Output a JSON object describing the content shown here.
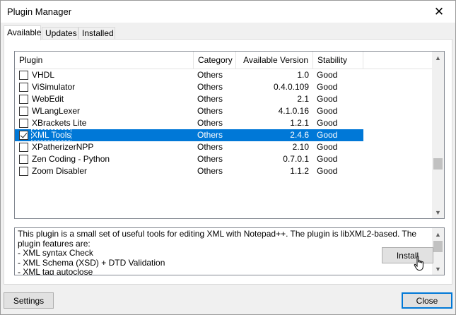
{
  "window": {
    "title": "Plugin Manager",
    "close_glyph": "✕"
  },
  "tabs": [
    {
      "label": "Available",
      "active": true
    },
    {
      "label": "Updates",
      "active": false
    },
    {
      "label": "Installed",
      "active": false
    }
  ],
  "list": {
    "columns": [
      "Plugin",
      "Category",
      "Available Version",
      "Stability"
    ],
    "rows": [
      {
        "checked": false,
        "name": "VHDL",
        "category": "Others",
        "version": "1.0",
        "stability": "Good",
        "selected": false
      },
      {
        "checked": false,
        "name": "ViSimulator",
        "category": "Others",
        "version": "0.4.0.109",
        "stability": "Good",
        "selected": false
      },
      {
        "checked": false,
        "name": "WebEdit",
        "category": "Others",
        "version": "2.1",
        "stability": "Good",
        "selected": false
      },
      {
        "checked": false,
        "name": "WLangLexer",
        "category": "Others",
        "version": "4.1.0.16",
        "stability": "Good",
        "selected": false
      },
      {
        "checked": false,
        "name": "XBrackets Lite",
        "category": "Others",
        "version": "1.2.1",
        "stability": "Good",
        "selected": false
      },
      {
        "checked": true,
        "name": "XML Tools",
        "category": "Others",
        "version": "2.4.6",
        "stability": "Good",
        "selected": true
      },
      {
        "checked": false,
        "name": "XPatherizerNPP",
        "category": "Others",
        "version": "2.10",
        "stability": "Good",
        "selected": false
      },
      {
        "checked": false,
        "name": "Zen Coding - Python",
        "category": "Others",
        "version": "0.7.0.1",
        "stability": "Good",
        "selected": false
      },
      {
        "checked": false,
        "name": "Zoom Disabler",
        "category": "Others",
        "version": "1.1.2",
        "stability": "Good",
        "selected": false
      }
    ],
    "selection_color": "#0078d7"
  },
  "description": {
    "text": "This plugin is a small set of useful tools for editing XML with Notepad++. The plugin is libXML2-based. The plugin features are:\n- XML syntax Check\n- XML Schema (XSD) + DTD Validation\n- XML tag autoclose"
  },
  "buttons": {
    "install": "Install",
    "settings": "Settings",
    "close": "Close"
  },
  "icons": {
    "scroll_up": "▲",
    "scroll_down": "▼"
  }
}
